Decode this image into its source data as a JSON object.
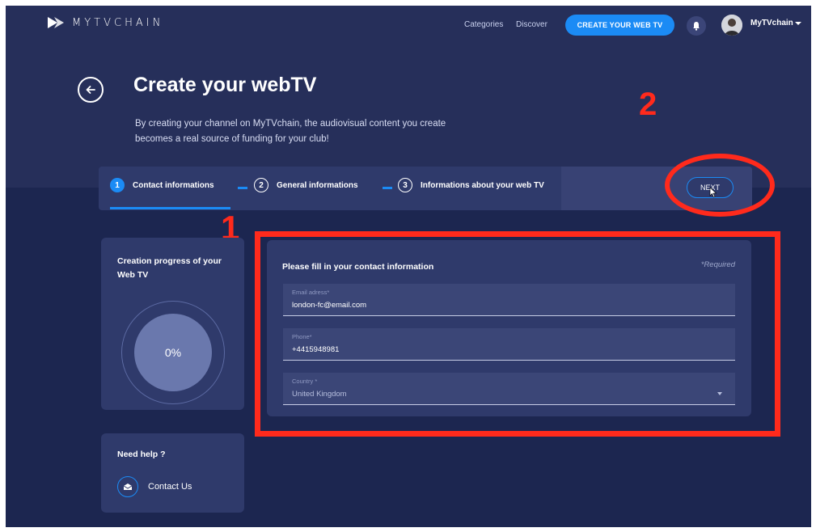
{
  "nav": {
    "brand": "MYTVCHAIN",
    "links": [
      "Categories",
      "Discover"
    ],
    "cta_label": "CREATE YOUR WEB TV",
    "username": "MyTVchain"
  },
  "header": {
    "title": "Create your webTV",
    "description": "By creating your channel on MyTVchain, the audiovisual content you create becomes a real source of funding for your club!"
  },
  "annotations": {
    "marker1": "1",
    "marker2": "2",
    "color": "#ff2a1c"
  },
  "stepper": {
    "steps": [
      {
        "num": "1",
        "label": "Contact informations",
        "active": true
      },
      {
        "num": "2",
        "label": "General informations",
        "active": false
      },
      {
        "num": "3",
        "label": "Informations about your web TV",
        "active": false
      }
    ],
    "next_label": "NEXT"
  },
  "progress": {
    "title": "Creation progress of your Web TV",
    "percent_label": "0%",
    "value": 0
  },
  "help": {
    "title": "Need help ?",
    "contact_label": "Contact Us"
  },
  "form": {
    "title": "Please fill in your contact information",
    "required_note": "*Required",
    "fields": [
      {
        "label": "Email adress*",
        "value": "london-fc@email.com"
      },
      {
        "label": "Phone*",
        "value": "+4415948981"
      },
      {
        "label": "Country *",
        "value": "United Kingdom"
      }
    ]
  },
  "colors": {
    "accent": "#1b8bf5",
    "background": "#1c2650",
    "card": "#2f3a6b"
  }
}
